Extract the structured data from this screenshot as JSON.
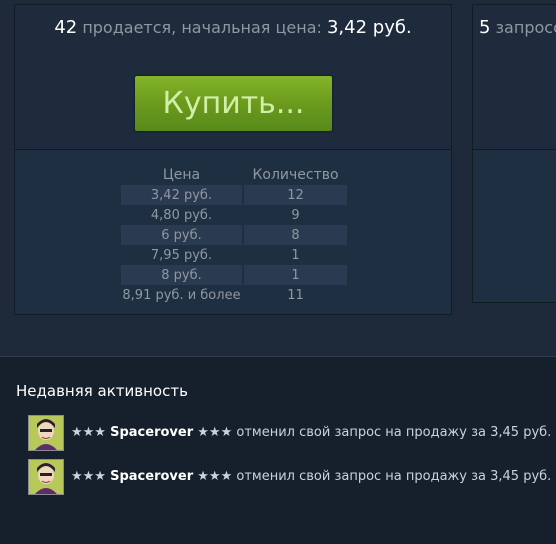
{
  "sell_panel": {
    "count": "42",
    "label": "продается, начальная цена:",
    "price": "3,42 руб.",
    "buy_button": "Купить..."
  },
  "buy_panel": {
    "count": "5",
    "label": "запросо"
  },
  "order_table": {
    "headers": {
      "price": "Цена",
      "quantity": "Количество"
    },
    "rows": [
      {
        "price": "3,42 руб.",
        "quantity": "12"
      },
      {
        "price": "4,80 руб.",
        "quantity": "9"
      },
      {
        "price": "6 руб.",
        "quantity": "8"
      },
      {
        "price": "7,95 руб.",
        "quantity": "1"
      },
      {
        "price": "8 руб.",
        "quantity": "1"
      },
      {
        "price": "8,91 руб. и более",
        "quantity": "11"
      }
    ]
  },
  "recent_activity": {
    "title": "Недавняя активность",
    "items": [
      {
        "stars_left": "★★★",
        "user": "Spacerover",
        "stars_right": "★★★",
        "text": "отменил свой запрос на продажу за 3,45 руб."
      },
      {
        "stars_left": "★★★",
        "user": "Spacerover",
        "stars_right": "★★★",
        "text": "отменил свой запрос на продажу за 3,45 руб."
      }
    ]
  },
  "colors": {
    "background": "#1b2838",
    "button_green": "#6b9a1c",
    "button_text": "#d2efa9",
    "muted_text": "#8f98a0"
  }
}
